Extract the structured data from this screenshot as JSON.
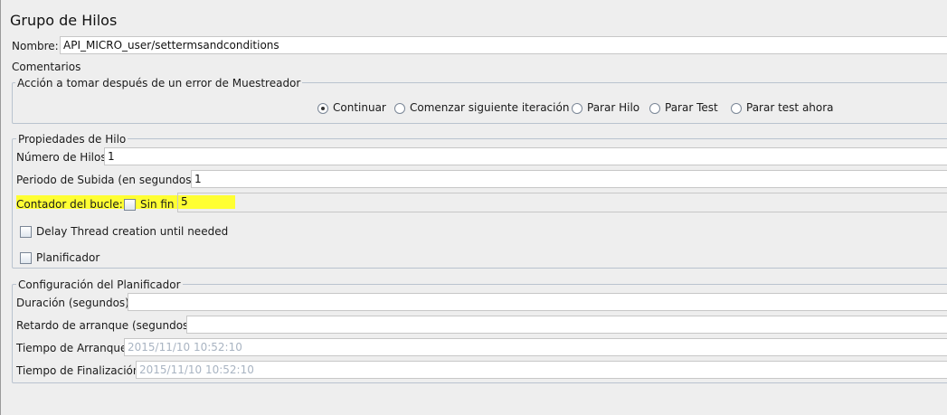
{
  "title": "Grupo de Hilos",
  "name": {
    "label": "Nombre:",
    "value": "API_MICRO_user/settermsandconditions"
  },
  "comments_label": "Comentarios",
  "error_action": {
    "legend": "Acción a tomar después de un error de Muestreador",
    "options": [
      {
        "label": "Continuar",
        "selected": true
      },
      {
        "label": "Comenzar siguiente iteración",
        "selected": false
      },
      {
        "label": "Parar Hilo",
        "selected": false
      },
      {
        "label": "Parar Test",
        "selected": false
      },
      {
        "label": "Parar test ahora",
        "selected": false
      }
    ]
  },
  "thread_props": {
    "legend": "Propiedades de Hilo",
    "num_threads_label": "Número de Hilos",
    "num_threads_value": "1",
    "ramp_up_label": "Periodo de Subida (en segundos):",
    "ramp_up_value": "1",
    "loop_label": "Contador del bucle:",
    "forever_label": "Sin fin",
    "loop_value": "5",
    "delay_label": "Delay Thread creation until needed",
    "scheduler_label": "Planificador",
    "highlight_color": "#ffff33"
  },
  "scheduler_config": {
    "legend": "Configuración del Planificador",
    "duration_label": "Duración (segundos)",
    "duration_value": "",
    "startup_delay_label": "Retardo de arranque (segundos)",
    "startup_delay_value": "",
    "start_time_label": "Tiempo de Arranque",
    "start_time_value": "2015/11/10 10:52:10",
    "end_time_label": "Tiempo de Finalización",
    "end_time_value": "2015/11/10 10:52:10"
  }
}
